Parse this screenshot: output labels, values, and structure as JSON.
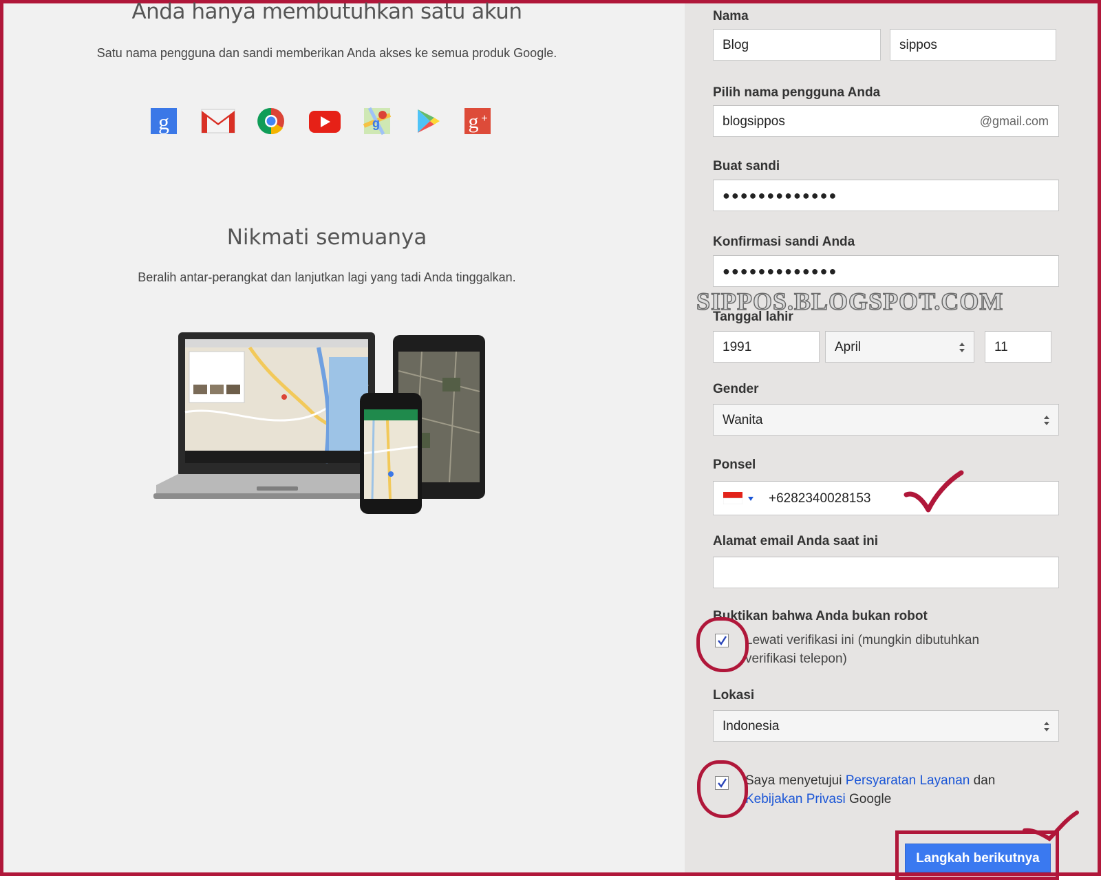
{
  "left": {
    "heading1": "Anda hanya membutuhkan satu akun",
    "subheading1": "Satu nama pengguna dan sandi memberikan Anda akses ke semua produk Google.",
    "product_icons": [
      "google-search-icon",
      "gmail-icon",
      "chrome-icon",
      "youtube-icon",
      "maps-icon",
      "play-icon",
      "google-plus-icon"
    ],
    "heading2": "Nikmati semuanya",
    "subheading2": "Beralih antar-perangkat dan lanjutkan lagi yang tadi Anda tinggalkan."
  },
  "form": {
    "name_label": "Nama",
    "first_name": "Blog",
    "last_name": "sippos",
    "username_label": "Pilih nama pengguna Anda",
    "username": "blogsippos",
    "username_suffix": "@gmail.com",
    "password_label": "Buat sandi",
    "password_mask": "●●●●●●●●●●●●●",
    "confirm_label": "Konfirmasi sandi Anda",
    "confirm_mask": "●●●●●●●●●●●●●",
    "birth_label": "Tanggal lahir",
    "birth_year": "1991",
    "birth_month": "April",
    "birth_day": "11",
    "gender_label": "Gender",
    "gender": "Wanita",
    "phone_label": "Ponsel",
    "phone": "+6282340028153",
    "email_label": "Alamat email Anda saat ini",
    "email": "",
    "robot_label": "Buktikan bahwa Anda bukan robot",
    "robot_checked": true,
    "robot_text_1": "Lewati verifikasi ini (mungkin dibutuhkan",
    "robot_text_2": "verifikasi telepon)",
    "location_label": "Lokasi",
    "location": "Indonesia",
    "terms_checked": true,
    "terms_prefix": "Saya menyetujui ",
    "terms_link": "Persyaratan Layanan",
    "terms_and": " dan",
    "privacy_link": "Kebijakan Privasi",
    "privacy_suffix": " Google",
    "next_button": "Langkah berikutnya"
  },
  "watermark": "SIPPOS.BLOGSPOT.COM",
  "colors": {
    "annotation_red": "#b0173a",
    "button_blue": "#3a79f0",
    "link_blue": "#1a55d6"
  }
}
